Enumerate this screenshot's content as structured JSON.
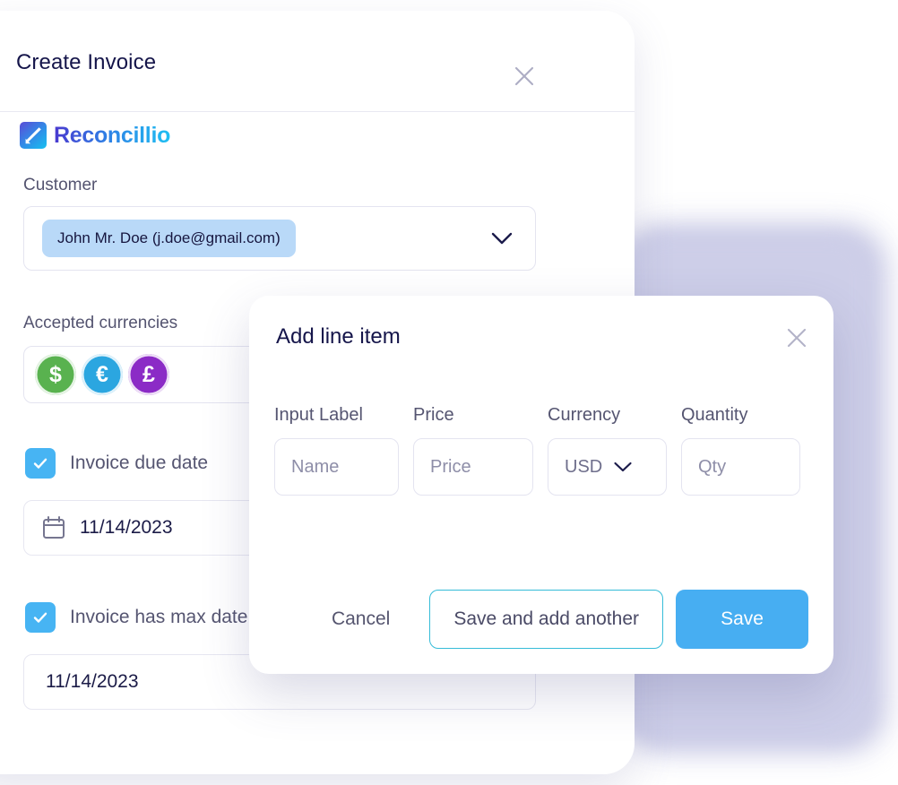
{
  "colors": {
    "accent_blue": "#47aef2",
    "outline_cyan": "#36bcd8",
    "title_navy": "#15154a",
    "label_gray": "#555571",
    "chip_blue": "#b9d9f8",
    "coin_usd": "#59b24f",
    "coin_eur": "#2ba6e0",
    "coin_gbp": "#8b2bc6",
    "halo_purple": "#c6c7e4"
  },
  "invoice_card": {
    "title": "Create Invoice",
    "close_icon": "close-icon",
    "brand": {
      "name": "Reconcillio",
      "mark_icon": "reconcillio-logo-icon"
    },
    "customer": {
      "label": "Customer",
      "selected_value": "John Mr. Doe (j.doe@gmail.com)",
      "caret_icon": "chevron-down-icon"
    },
    "currencies": {
      "label": "Accepted currencies",
      "items": [
        {
          "code": "USD",
          "symbol": "$",
          "icon": "dollar-coin-icon"
        },
        {
          "code": "EUR",
          "symbol": "€",
          "icon": "euro-coin-icon"
        },
        {
          "code": "GBP",
          "symbol": "£",
          "icon": "pound-coin-icon"
        }
      ]
    },
    "due_date": {
      "checkbox_label": "Invoice due date",
      "checked": true,
      "calendar_icon": "calendar-icon",
      "value": "11/14/2023"
    },
    "max_date": {
      "checkbox_label": "Invoice has max date",
      "checked": true,
      "value": "11/14/2023"
    }
  },
  "line_item_modal": {
    "title": "Add line item",
    "close_icon": "close-icon",
    "fields": [
      {
        "label": "Input Label",
        "placeholder": "Name",
        "value": ""
      },
      {
        "label": "Price",
        "placeholder": "Price",
        "value": ""
      },
      {
        "label": "Currency",
        "selected": "USD",
        "caret_icon": "chevron-down-icon"
      },
      {
        "label": "Quantity",
        "placeholder": "Qty",
        "value": ""
      }
    ],
    "buttons": {
      "cancel": "Cancel",
      "save_and_add": "Save and add another",
      "save": "Save"
    }
  }
}
